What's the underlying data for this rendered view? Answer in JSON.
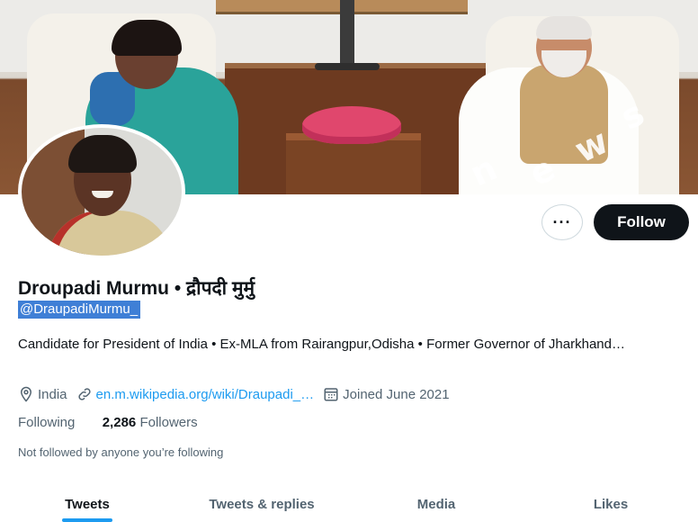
{
  "profile": {
    "name": "Droupadi Murmu • द्रौपदी मुर्मु",
    "handle": "@DraupadiMurmu_",
    "bio": "Candidate for President of India • Ex-MLA from Rairangpur,Odisha • Former Governor of Jharkhand…",
    "location": "India",
    "website": "en.m.wikipedia.org/wiki/Draupadi_…",
    "joined": "Joined June 2021",
    "following_label": "Following",
    "followers_count": "2,286",
    "followers_label": "Followers",
    "not_followed": "Not followed by anyone you’re following"
  },
  "actions": {
    "more": "···",
    "follow": "Follow"
  },
  "tabs": [
    {
      "label": "Tweets",
      "active": true
    },
    {
      "label": "Tweets & replies",
      "active": false
    },
    {
      "label": "Media",
      "active": false
    },
    {
      "label": "Likes",
      "active": false
    }
  ],
  "icons": {
    "location": "location-pin-icon",
    "link": "link-icon",
    "calendar": "calendar-icon"
  },
  "colors": {
    "accent": "#1d9bf0",
    "follow_bg": "#0f1419",
    "muted": "#536471"
  }
}
